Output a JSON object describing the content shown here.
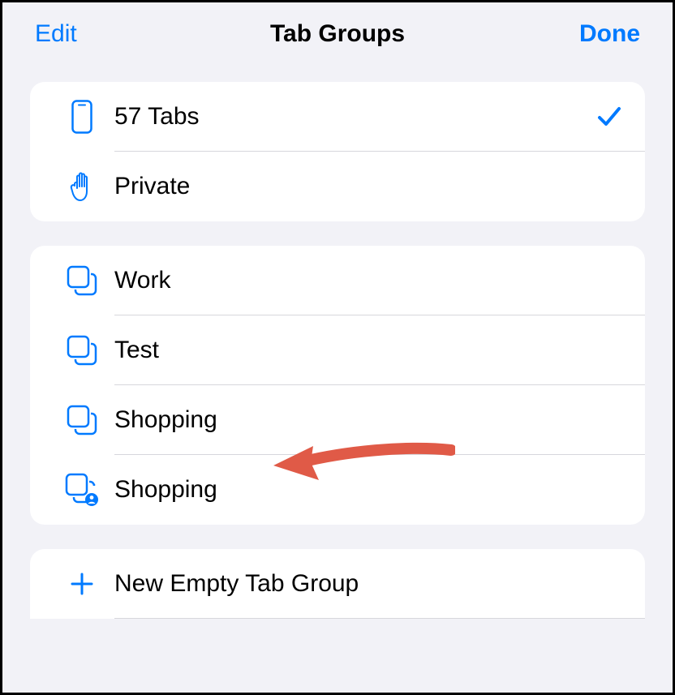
{
  "header": {
    "edit": "Edit",
    "title": "Tab Groups",
    "done": "Done"
  },
  "colors": {
    "accent": "#007aff",
    "annotation": "#e05a47"
  },
  "section1": {
    "items": [
      {
        "label": "57 Tabs",
        "icon": "phone-icon",
        "checked": true
      },
      {
        "label": "Private",
        "icon": "hand-icon",
        "checked": false
      }
    ]
  },
  "section2": {
    "items": [
      {
        "label": "Work",
        "icon": "stack-icon"
      },
      {
        "label": "Test",
        "icon": "stack-icon"
      },
      {
        "label": "Shopping",
        "icon": "stack-icon"
      },
      {
        "label": "Shopping",
        "icon": "stack-person-icon"
      }
    ]
  },
  "section3": {
    "items": [
      {
        "label": "New Empty Tab Group",
        "icon": "plus-icon"
      }
    ]
  }
}
